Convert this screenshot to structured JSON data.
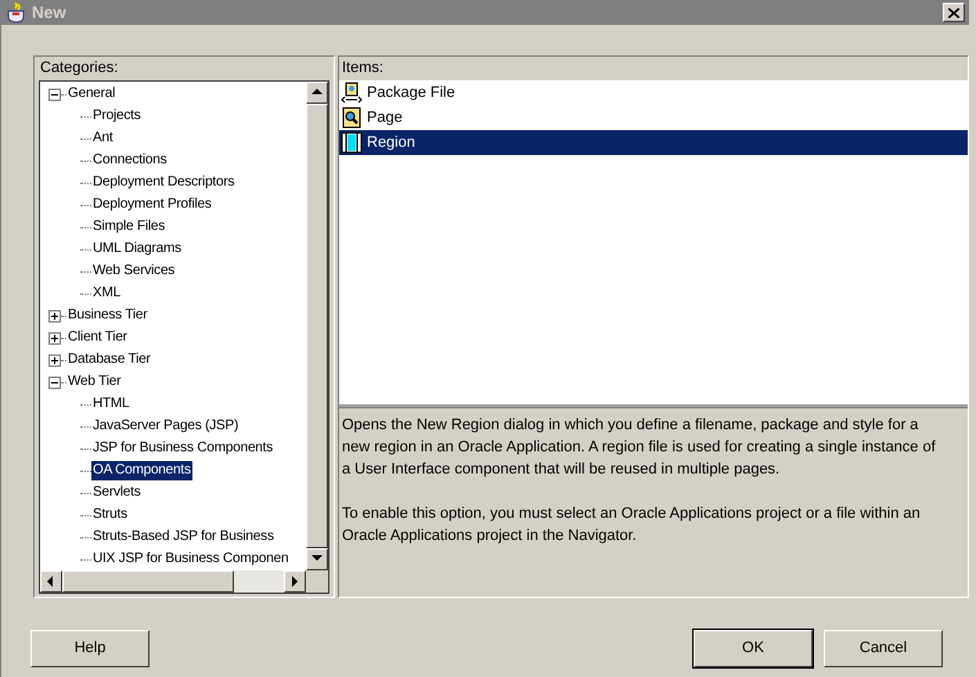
{
  "window": {
    "title": "New"
  },
  "categories": {
    "label": "Categories:",
    "tree": [
      {
        "label": "General",
        "expanded": true,
        "selected": false,
        "children": [
          {
            "label": "Projects",
            "selected": false
          },
          {
            "label": "Ant",
            "selected": false
          },
          {
            "label": "Connections",
            "selected": false
          },
          {
            "label": "Deployment Descriptors",
            "selected": false
          },
          {
            "label": "Deployment Profiles",
            "selected": false
          },
          {
            "label": "Simple Files",
            "selected": false
          },
          {
            "label": "UML Diagrams",
            "selected": false
          },
          {
            "label": "Web Services",
            "selected": false
          },
          {
            "label": "XML",
            "selected": false
          }
        ]
      },
      {
        "label": "Business Tier",
        "expanded": false,
        "selected": false
      },
      {
        "label": "Client Tier",
        "expanded": false,
        "selected": false
      },
      {
        "label": "Database Tier",
        "expanded": false,
        "selected": false
      },
      {
        "label": "Web Tier",
        "expanded": true,
        "selected": false,
        "children": [
          {
            "label": "HTML",
            "selected": false
          },
          {
            "label": "JavaServer Pages (JSP)",
            "selected": false
          },
          {
            "label": "JSP for Business Components",
            "selected": false
          },
          {
            "label": "OA Components",
            "selected": true
          },
          {
            "label": "Servlets",
            "selected": false
          },
          {
            "label": "Struts",
            "selected": false
          },
          {
            "label": "Struts-Based JSP for Business",
            "selected": false
          },
          {
            "label": "UIX JSP for Business Componen",
            "selected": false
          }
        ]
      }
    ]
  },
  "items": {
    "label": "Items:",
    "list": [
      {
        "label": "Package File",
        "kind": "package",
        "selected": false
      },
      {
        "label": "Page",
        "kind": "page",
        "selected": false
      },
      {
        "label": "Region",
        "kind": "region",
        "selected": true
      }
    ]
  },
  "description": [
    "Opens the New Region dialog in which you define a filename, package and style for a new region in an Oracle Application. A region file is used for creating a single instance of a User Interface component that will be reused in multiple pages.",
    "To enable this option, you must select an Oracle Applications project or a file within an Oracle Applications project in the Navigator."
  ],
  "buttons": {
    "help": "Help",
    "ok": "OK",
    "cancel": "Cancel"
  }
}
